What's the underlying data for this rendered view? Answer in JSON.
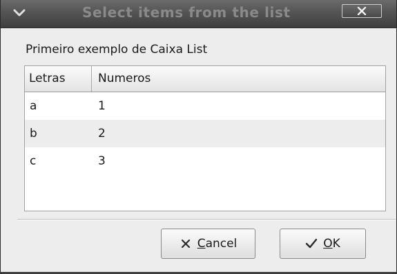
{
  "window": {
    "title": "Select items from the list",
    "menu_icon": "chevron-down-icon",
    "close_icon": "close-icon"
  },
  "dialog": {
    "prompt": "Primeiro exemplo de Caixa List"
  },
  "list": {
    "columns": [
      "Letras",
      "Numeros"
    ],
    "rows": [
      {
        "letra": "a",
        "numero": "1"
      },
      {
        "letra": "b",
        "numero": "2"
      },
      {
        "letra": "c",
        "numero": "3"
      }
    ]
  },
  "buttons": {
    "cancel": {
      "mnemonic": "C",
      "rest": "ancel",
      "icon": "x-icon"
    },
    "ok": {
      "mnemonic": "O",
      "rest": "K",
      "icon": "check-icon"
    }
  },
  "colors": {
    "titlebar": "#545454",
    "title_text": "#8a8a8a",
    "dialog_bg": "#ededed",
    "alt_row": "#ededed"
  }
}
